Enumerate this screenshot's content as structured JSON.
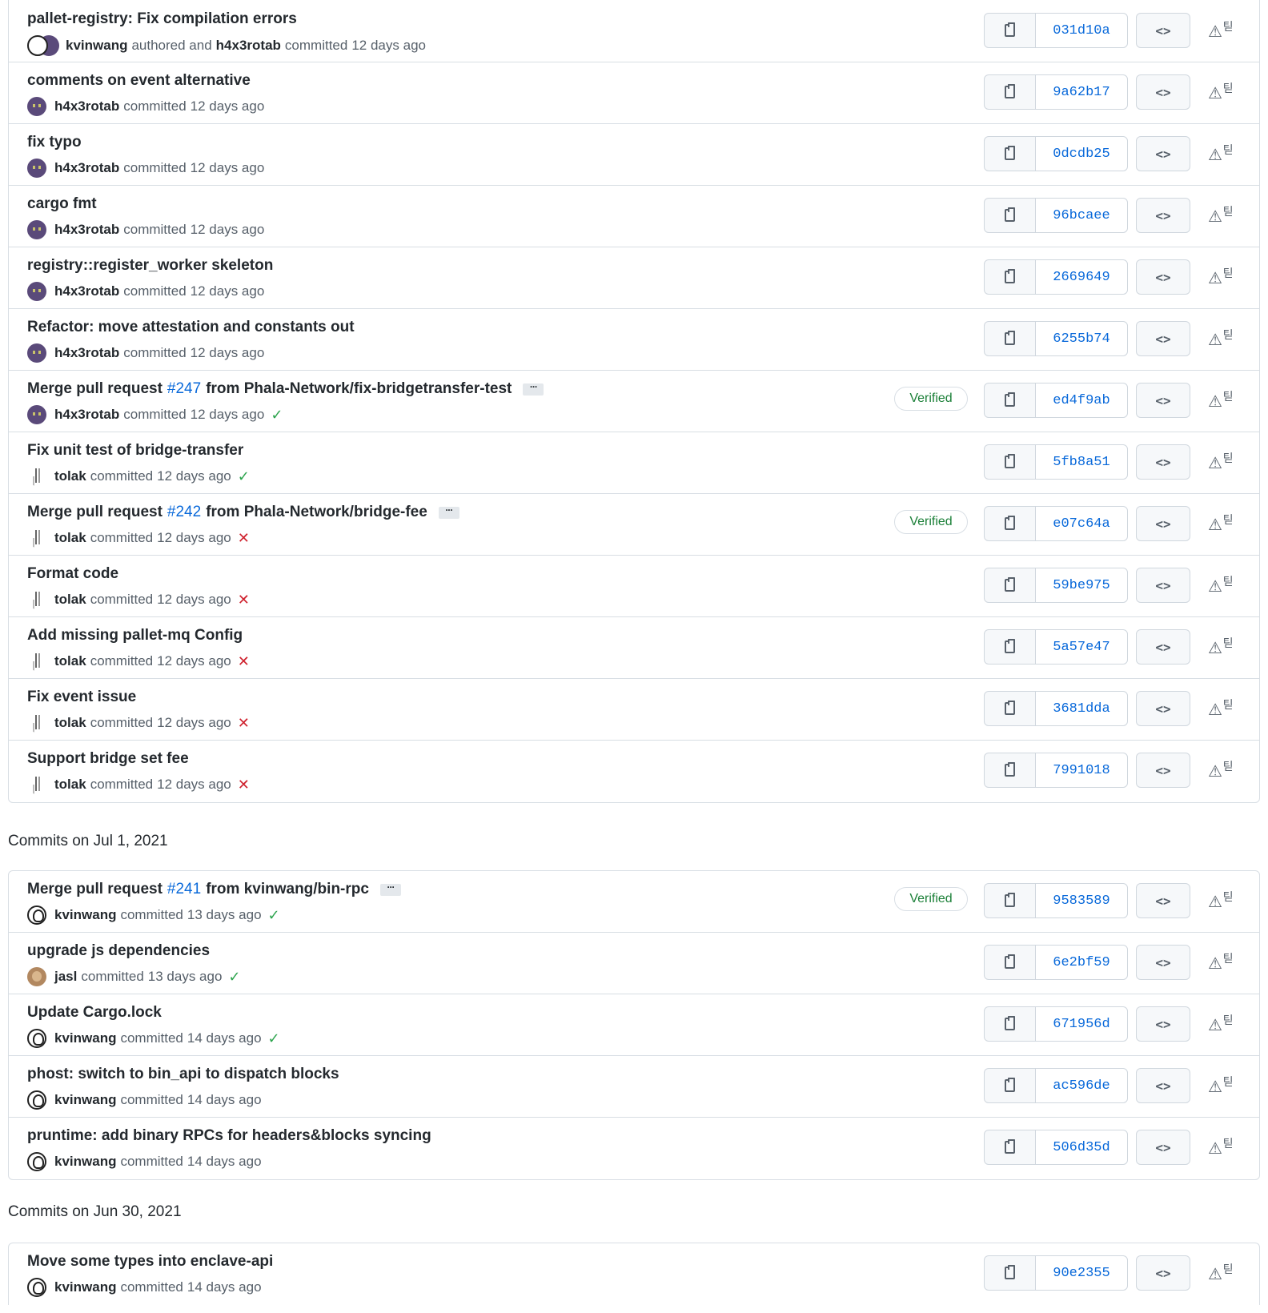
{
  "groups": [
    {
      "heading": "",
      "commits": [
        {
          "message": "pallet-registry: Fix compilation errors",
          "author": "kvinwang",
          "co_text": "authored and",
          "committer": "h4x3rotab",
          "action": "committed",
          "time": "12 days ago",
          "status": "",
          "verified": "",
          "sha": "031d10a",
          "avatar": "double"
        },
        {
          "message": "comments on event alternative",
          "author": "h4x3rotab",
          "action": "committed",
          "time": "12 days ago",
          "status": "",
          "verified": "",
          "sha": "9a62b17",
          "avatar": "h4x"
        },
        {
          "message": "fix typo",
          "author": "h4x3rotab",
          "action": "committed",
          "time": "12 days ago",
          "status": "",
          "verified": "",
          "sha": "0dcdb25",
          "avatar": "h4x"
        },
        {
          "message": "cargo fmt",
          "author": "h4x3rotab",
          "action": "committed",
          "time": "12 days ago",
          "status": "",
          "verified": "",
          "sha": "96bcaee",
          "avatar": "h4x"
        },
        {
          "message": "registry::register_worker skeleton",
          "author": "h4x3rotab",
          "action": "committed",
          "time": "12 days ago",
          "status": "",
          "verified": "",
          "sha": "2669649",
          "avatar": "h4x"
        },
        {
          "message": "Refactor: move attestation and constants out",
          "author": "h4x3rotab",
          "action": "committed",
          "time": "12 days ago",
          "status": "",
          "verified": "",
          "sha": "6255b74",
          "avatar": "h4x"
        },
        {
          "message_pre": "Merge pull request",
          "pr": "#247",
          "message_post": "from Phala-Network/fix-bridgetransfer-test",
          "ellipsis": "···",
          "author": "h4x3rotab",
          "action": "committed",
          "time": "12 days ago",
          "status": "ok",
          "verified": "Verified",
          "sha": "ed4f9ab",
          "avatar": "h4x"
        },
        {
          "message": "Fix unit test of bridge-transfer",
          "author": "tolak",
          "action": "committed",
          "time": "12 days ago",
          "status": "ok",
          "verified": "",
          "sha": "5fb8a51",
          "avatar": "tolak"
        },
        {
          "message_pre": "Merge pull request",
          "pr": "#242",
          "message_post": "from Phala-Network/bridge-fee",
          "ellipsis": "···",
          "author": "tolak",
          "action": "committed",
          "time": "12 days ago",
          "status": "fail",
          "verified": "Verified",
          "sha": "e07c64a",
          "avatar": "tolak"
        },
        {
          "message": "Format code",
          "author": "tolak",
          "action": "committed",
          "time": "12 days ago",
          "status": "fail",
          "verified": "",
          "sha": "59be975",
          "avatar": "tolak"
        },
        {
          "message": "Add missing pallet-mq Config",
          "author": "tolak",
          "action": "committed",
          "time": "12 days ago",
          "status": "fail",
          "verified": "",
          "sha": "5a57e47",
          "avatar": "tolak"
        },
        {
          "message": "Fix event issue",
          "author": "tolak",
          "action": "committed",
          "time": "12 days ago",
          "status": "fail",
          "verified": "",
          "sha": "3681dda",
          "avatar": "tolak"
        },
        {
          "message": "Support bridge set fee",
          "author": "tolak",
          "action": "committed",
          "time": "12 days ago",
          "status": "fail",
          "verified": "",
          "sha": "7991018",
          "avatar": "tolak"
        }
      ]
    },
    {
      "heading": "Commits on Jul 1, 2021",
      "commits": [
        {
          "message_pre": "Merge pull request",
          "pr": "#241",
          "message_post": "from kvinwang/bin-rpc",
          "ellipsis": "···",
          "author": "kvinwang",
          "action": "committed",
          "time": "13 days ago",
          "status": "ok",
          "verified": "Verified",
          "sha": "9583589",
          "avatar": "kvin"
        },
        {
          "message": "upgrade js dependencies",
          "author": "jasl",
          "action": "committed",
          "time": "13 days ago",
          "status": "ok",
          "verified": "",
          "sha": "6e2bf59",
          "avatar": "jasl"
        },
        {
          "message": "Update Cargo.lock",
          "author": "kvinwang",
          "action": "committed",
          "time": "14 days ago",
          "status": "ok",
          "verified": "",
          "sha": "671956d",
          "avatar": "kvin"
        },
        {
          "message": "phost: switch to bin_api to dispatch blocks",
          "author": "kvinwang",
          "action": "committed",
          "time": "14 days ago",
          "status": "",
          "verified": "",
          "sha": "ac596de",
          "avatar": "kvin"
        },
        {
          "message": "pruntime: add binary RPCs for headers&blocks syncing",
          "author": "kvinwang",
          "action": "committed",
          "time": "14 days ago",
          "status": "",
          "verified": "",
          "sha": "506d35d",
          "avatar": "kvin"
        }
      ]
    },
    {
      "heading": "Commits on Jun 30, 2021",
      "commits": [
        {
          "message": "Move some types into enclave-api",
          "author": "kvinwang",
          "action": "committed",
          "time": "14 days ago",
          "status": "",
          "verified": "",
          "sha": "90e2355",
          "avatar": "kvin"
        }
      ]
    }
  ],
  "icons": {
    "copy": "clipboard-icon",
    "browse": "code-icon",
    "extension": "warning-triangle-icon",
    "ok": "check-icon",
    "fail": "x-icon"
  },
  "glyphs": {
    "browse": "<>",
    "ext_main": "⚠",
    "ext_sub": "틷",
    "ok": "✓",
    "fail": "✕"
  },
  "colors": {
    "link": "#0969da",
    "success": "#2da44e",
    "danger": "#cf222e",
    "border": "#d8dee4"
  }
}
